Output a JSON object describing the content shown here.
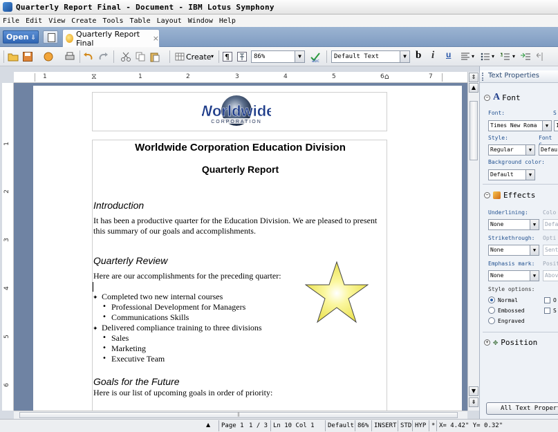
{
  "window": {
    "title": "Quarterly Report Final - Document - IBM Lotus Symphony"
  },
  "menu": [
    "File",
    "Edit",
    "View",
    "Create",
    "Tools",
    "Table",
    "Layout",
    "Window",
    "Help"
  ],
  "tabs": {
    "open_label": "Open",
    "document_tab": "Quarterly Report Final",
    "close_glyph": "×"
  },
  "toolbar": {
    "create_label": "Create",
    "zoom_value": "86%",
    "style_value": "Default Text",
    "bold": "b",
    "italic": "i",
    "underline": "u"
  },
  "ruler": {
    "labels": [
      "1",
      "1",
      "2",
      "3",
      "4",
      "5",
      "6",
      "7"
    ],
    "vertical_labels": [
      "1",
      "2",
      "3",
      "4",
      "5",
      "6"
    ]
  },
  "document": {
    "logo_text": "Worldwide",
    "logo_subtext": "CORPORATION",
    "heading1": "Worldwide Corporation Education Division",
    "heading2": "Quarterly Report",
    "sections": [
      {
        "title": "Introduction",
        "body": "It has been a productive quarter for the Education Division. We are pleased to present this summary of our goals and accomplishments."
      },
      {
        "title": "Quarterly Review",
        "body": "Here are our accomplishments for the preceding quarter:"
      },
      {
        "title": "Goals for the Future",
        "body": "Here is our list of upcoming goals in order of priority:"
      }
    ],
    "bullets": [
      {
        "text": "Completed two new internal courses",
        "sub": [
          "Professional Development for Managers",
          "Communications Skills"
        ]
      },
      {
        "text": "Delivered compliance training to three divisions",
        "sub": [
          "Sales",
          "Marketing",
          "Executive Team"
        ]
      }
    ],
    "shape": "star-shape"
  },
  "panel": {
    "title": "Text Properties",
    "font_section": "Font",
    "font_label": "Font:",
    "font_value": "Times New Roma",
    "size_label": "S",
    "size_value": "1",
    "style_label": "Style:",
    "style_value": "Regular",
    "font_color_label": "Font c",
    "font_color_value": "Defau",
    "bg_label": "Background color:",
    "bg_value": "Default",
    "effects_section": "Effects",
    "underlining_label": "Underlining:",
    "underlining_value": "None",
    "color_label": "Colo",
    "color_value": "Defa",
    "strike_label": "Strikethrough:",
    "strike_value": "None",
    "option_label": "Opti",
    "option_value": "Sent",
    "emphasis_label": "Emphasis mark:",
    "emphasis_value": "None",
    "position_label": "Positi",
    "position_value": "Abov",
    "style_options_label": "Style options:",
    "radio_normal": "Normal",
    "radio_embossed": "Embossed",
    "radio_engraved": "Engraved",
    "check_o": "O",
    "check_s": "S",
    "position_section": "Position",
    "all_button": "All Text Properties"
  },
  "status": {
    "page": "Page 1",
    "pages": "1 / 3",
    "line_col": "Ln 10 Col 1",
    "style": "Default",
    "zoom": "86%",
    "insert": "INSERT",
    "std": "STD",
    "hyp": "HYP",
    "star": "*",
    "coords": "X= 4.42\" Y= 0.32\""
  }
}
